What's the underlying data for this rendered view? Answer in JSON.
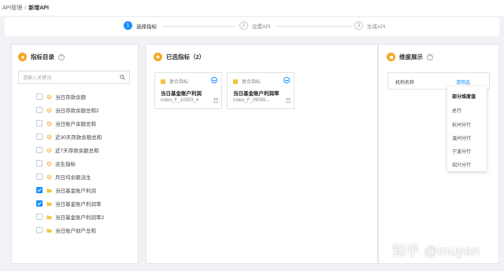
{
  "breadcrumb": {
    "parent": "API管理",
    "separator": "/",
    "current": "新增API"
  },
  "steps": [
    {
      "num": "1",
      "label": "选择指标",
      "active": true
    },
    {
      "num": "2",
      "label": "设置API",
      "active": false
    },
    {
      "num": "3",
      "label": "生成API",
      "active": false
    }
  ],
  "catalog": {
    "title": "指标目录",
    "info": "?",
    "search_placeholder": "请输入关键词",
    "items": [
      {
        "label": "当日存款余额",
        "checked": false,
        "icon": "gear-icon"
      },
      {
        "label": "当日存款余额总和2",
        "checked": false,
        "icon": "gear-icon"
      },
      {
        "label": "当日账户余额总和",
        "checked": false,
        "icon": "gear-icon"
      },
      {
        "label": "近30天存款余额总和",
        "checked": false,
        "icon": "gear-icon"
      },
      {
        "label": "近7天存款余额总和",
        "checked": false,
        "icon": "gear-icon"
      },
      {
        "label": "派生指标",
        "checked": false,
        "icon": "gear-icon"
      },
      {
        "label": "月日均余额派生",
        "checked": false,
        "icon": "gear-icon"
      },
      {
        "label": "当日基金账户利润",
        "checked": true,
        "icon": "folder-icon"
      },
      {
        "label": "当日基金账户利润率",
        "checked": true,
        "icon": "folder-icon"
      },
      {
        "label": "当日基金账户利润率2",
        "checked": false,
        "icon": "folder-icon"
      },
      {
        "label": "当日账户财产总和",
        "checked": false,
        "icon": "folder-icon"
      }
    ]
  },
  "selected": {
    "title": "已选指标（2）",
    "cards": [
      {
        "tag": "复合指标",
        "name": "当日基金账户利润",
        "code": "index_F_10903_4"
      },
      {
        "tag": "复合指标",
        "name": "当日基金账户利润率",
        "code": "index_F_09089..."
      }
    ]
  },
  "dimension": {
    "title": "维度展示",
    "info": "?",
    "row_label": "机构名称",
    "row_link": "请筛选",
    "dropdown": {
      "header": "部分维度值",
      "options": [
        "总行",
        "杭州分行",
        "温州分行",
        "宁波分行",
        "绍兴分行"
      ]
    }
  },
  "watermark": "知乎 @muyan",
  "colors": {
    "primary": "#1890ff",
    "accent": "#f5a623",
    "folder": "#f5c542"
  }
}
